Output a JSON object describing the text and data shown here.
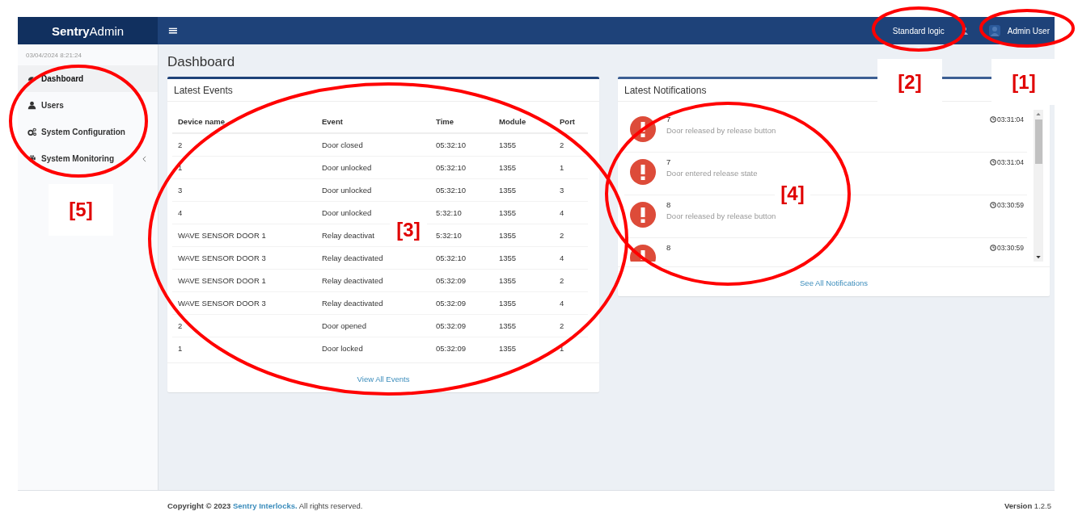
{
  "brand": "**Sentry**Admin",
  "header": {
    "menu_glyph": "≡",
    "mode": "Standard logic",
    "user": "Admin User"
  },
  "sidebar": {
    "datetime": "03/04/2024 8:21:24",
    "items": [
      {
        "label": "Dashboard",
        "selected": true,
        "has_children": false
      },
      {
        "label": "Users",
        "selected": false,
        "has_children": false
      },
      {
        "label": "System Configuration",
        "selected": false,
        "has_children": false
      },
      {
        "label": "System Monitoring",
        "selected": false,
        "has_children": true
      }
    ]
  },
  "page_title": "Dashboard",
  "events": {
    "title": "Latest Events",
    "columns": [
      "Device name",
      "Event",
      "Time",
      "Module",
      "Port"
    ],
    "rows": [
      [
        "2",
        "Door closed",
        "05:32:10",
        "1355",
        "2"
      ],
      [
        "1",
        "Door unlocked",
        "05:32:10",
        "1355",
        "1"
      ],
      [
        "3",
        "Door unlocked",
        "05:32:10",
        "1355",
        "3"
      ],
      [
        "4",
        "Door unlocked",
        "5:32:10",
        "1355",
        "4"
      ],
      [
        "WAVE SENSOR DOOR 1",
        "Relay deactivat",
        "5:32:10",
        "1355",
        "2"
      ],
      [
        "WAVE SENSOR DOOR 3",
        "Relay deactivated",
        "05:32:10",
        "1355",
        "4"
      ],
      [
        "WAVE SENSOR DOOR 1",
        "Relay deactivated",
        "05:32:09",
        "1355",
        "2"
      ],
      [
        "WAVE SENSOR DOOR 3",
        "Relay deactivated",
        "05:32:09",
        "1355",
        "4"
      ],
      [
        "2",
        "Door opened",
        "05:32:09",
        "1355",
        "2"
      ],
      [
        "1",
        "Door locked",
        "05:32:09",
        "1355",
        "1"
      ]
    ],
    "link": "View All Events"
  },
  "notifications": {
    "title": "Latest Notifications",
    "items": [
      {
        "title": "7",
        "message": "Door released by release button",
        "time": "03:31:04"
      },
      {
        "title": "7",
        "message": "Door entered release state",
        "time": "03:31:04"
      },
      {
        "title": "8",
        "message": "Door released by release button",
        "time": "03:30:59"
      },
      {
        "title": "8",
        "time": "03:30:59"
      }
    ],
    "link": "See All Notifications"
  },
  "footer": {
    "copyright": "**Copyright © 2023** ",
    "company": "Sentry Interlocks.",
    "rights": " All rights reserved.",
    "version_label": "Version",
    "version": "1.2.5"
  },
  "annotations": [
    {
      "label": "[1]"
    },
    {
      "label": "[2]"
    },
    {
      "label": "[3]"
    },
    {
      "label": "[4]"
    },
    {
      "label": "[5]"
    }
  ]
}
